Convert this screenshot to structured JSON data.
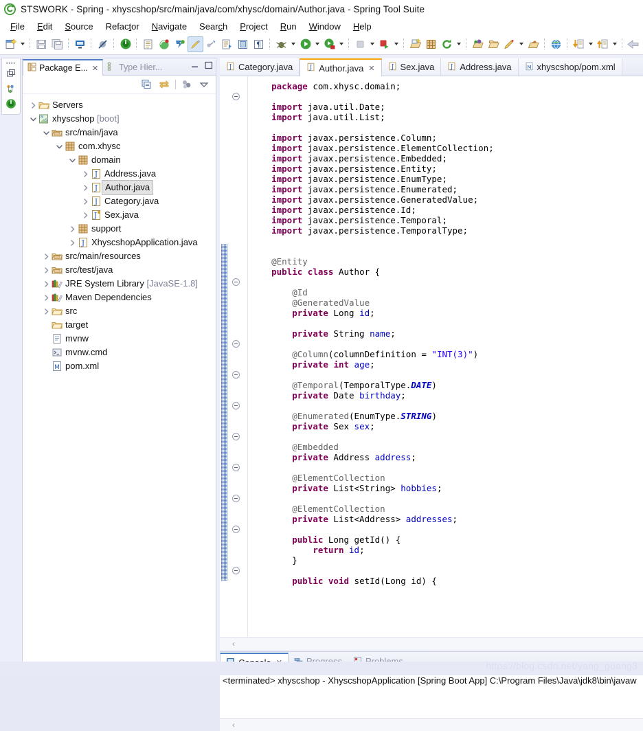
{
  "window": {
    "title": "STSWORK - Spring - xhyscshop/src/main/java/com/xhysc/domain/Author.java - Spring Tool Suite",
    "logo_icon": "sts-logo-icon"
  },
  "menubar": {
    "items": [
      {
        "label": "File",
        "mnemonic": "F"
      },
      {
        "label": "Edit",
        "mnemonic": "E"
      },
      {
        "label": "Source",
        "mnemonic": "S"
      },
      {
        "label": "Refactor",
        "mnemonic": "t"
      },
      {
        "label": "Navigate",
        "mnemonic": "N"
      },
      {
        "label": "Search",
        "mnemonic": "c"
      },
      {
        "label": "Project",
        "mnemonic": "P"
      },
      {
        "label": "Run",
        "mnemonic": "R"
      },
      {
        "label": "Window",
        "mnemonic": "W"
      },
      {
        "label": "Help",
        "mnemonic": "H"
      }
    ]
  },
  "toolbar": {
    "groups": [
      [
        "new-wizard-icon",
        "dropdown",
        "sep"
      ],
      [
        "save-icon",
        "save-all-icon",
        "sep"
      ],
      [
        "print-icon",
        "sep"
      ],
      [
        "toggle-breakpoint-icon",
        "sep"
      ],
      [
        "boot-dashboard-icon",
        "sep"
      ],
      [
        "new-java-class-icon",
        "spring-boot-icon",
        "spring-icon",
        "quick-access-highlight-icon",
        "link-icon",
        "externalize-strings-icon",
        "toggle-block-selection-icon",
        "show-whitespace-icon",
        "sep"
      ],
      [
        "debug-icon",
        "dropdown",
        "run-icon",
        "dropdown",
        "run-server-icon",
        "dropdown",
        "sep"
      ],
      [
        "stop-icon",
        "dropdown",
        "terminate-relaunch-icon",
        "dropdown",
        "sep"
      ],
      [
        "new-java-project-icon",
        "new-package-icon",
        "refresh-icon",
        "dropdown",
        "sep"
      ],
      [
        "open-type-icon",
        "open-task-icon",
        "new-annotation-icon",
        "dropdown",
        "open-resource-icon",
        "sep"
      ],
      [
        "web-browser-icon",
        "sep"
      ],
      [
        "previous-annotation-icon",
        "dropdown",
        "next-annotation-icon",
        "dropdown",
        "sep"
      ],
      [
        "back-icon",
        "forward-icon"
      ]
    ]
  },
  "fast_view": {
    "icons": [
      "restore-icon",
      "outline-minimized-icon",
      "boot-dashboard-minimized-icon"
    ]
  },
  "package_explorer": {
    "tabs": [
      {
        "label": "Package E...",
        "icon": "package-explorer-icon",
        "active": true,
        "closeable": true
      },
      {
        "label": "Type Hier...",
        "icon": "type-hierarchy-icon",
        "active": false,
        "closeable": false
      }
    ],
    "view_controls": [
      "minimize-icon",
      "maximize-icon"
    ],
    "toolbar_icons": [
      "collapse-all-icon",
      "link-with-editor-icon",
      "view-menu-focus-icon",
      "view-menu-icon"
    ],
    "tree": [
      {
        "indent": 0,
        "twisty": "collapsed",
        "icon": "folder-icon",
        "label": "Servers",
        "suffix": "",
        "selected": false
      },
      {
        "indent": 0,
        "twisty": "expanded",
        "icon": "spring-project-icon",
        "label": "xhyscshop",
        "suffix": " [boot]",
        "selected": false
      },
      {
        "indent": 1,
        "twisty": "expanded",
        "icon": "source-folder-icon",
        "label": "src/main/java",
        "suffix": "",
        "selected": false
      },
      {
        "indent": 2,
        "twisty": "expanded",
        "icon": "package-icon",
        "label": "com.xhysc",
        "suffix": "",
        "selected": false
      },
      {
        "indent": 3,
        "twisty": "expanded",
        "icon": "package-icon",
        "label": "domain",
        "suffix": "",
        "selected": false
      },
      {
        "indent": 4,
        "twisty": "collapsed",
        "icon": "java-file-icon",
        "label": "Address.java",
        "suffix": "",
        "selected": false
      },
      {
        "indent": 4,
        "twisty": "collapsed",
        "icon": "java-file-icon",
        "label": "Author.java",
        "suffix": "",
        "selected": true
      },
      {
        "indent": 4,
        "twisty": "collapsed",
        "icon": "java-file-icon",
        "label": "Category.java",
        "suffix": "",
        "selected": false
      },
      {
        "indent": 4,
        "twisty": "collapsed",
        "icon": "java-enum-file-icon",
        "label": "Sex.java",
        "suffix": "",
        "selected": false
      },
      {
        "indent": 3,
        "twisty": "collapsed",
        "icon": "package-icon",
        "label": "support",
        "suffix": "",
        "selected": false
      },
      {
        "indent": 3,
        "twisty": "collapsed",
        "icon": "java-file-icon",
        "label": "XhyscshopApplication.java",
        "suffix": "",
        "selected": false
      },
      {
        "indent": 1,
        "twisty": "collapsed",
        "icon": "source-folder-icon",
        "label": "src/main/resources",
        "suffix": "",
        "selected": false
      },
      {
        "indent": 1,
        "twisty": "collapsed",
        "icon": "source-folder-icon",
        "label": "src/test/java",
        "suffix": "",
        "selected": false
      },
      {
        "indent": 1,
        "twisty": "collapsed",
        "icon": "library-icon",
        "label": "JRE System Library",
        "suffix": " [JavaSE-1.8]",
        "selected": false
      },
      {
        "indent": 1,
        "twisty": "collapsed",
        "icon": "library-icon",
        "label": "Maven Dependencies",
        "suffix": "",
        "selected": false
      },
      {
        "indent": 1,
        "twisty": "collapsed",
        "icon": "folder-icon",
        "label": "src",
        "suffix": "",
        "selected": false
      },
      {
        "indent": 1,
        "twisty": "none",
        "icon": "folder-icon",
        "label": "target",
        "suffix": "",
        "selected": false
      },
      {
        "indent": 1,
        "twisty": "none",
        "icon": "file-icon",
        "label": "mvnw",
        "suffix": "",
        "selected": false
      },
      {
        "indent": 1,
        "twisty": "none",
        "icon": "cmd-file-icon",
        "label": "mvnw.cmd",
        "suffix": "",
        "selected": false
      },
      {
        "indent": 1,
        "twisty": "none",
        "icon": "xml-file-icon",
        "label": "pom.xml",
        "suffix": "",
        "selected": false
      }
    ]
  },
  "editor": {
    "tabs": [
      {
        "label": "Category.java",
        "icon": "java-file-icon",
        "active": false,
        "closeable": false
      },
      {
        "label": "Author.java",
        "icon": "java-file-icon",
        "active": true,
        "closeable": true
      },
      {
        "label": "Sex.java",
        "icon": "java-file-icon",
        "active": false,
        "closeable": false
      },
      {
        "label": "Address.java",
        "icon": "java-file-icon",
        "active": false,
        "closeable": false
      },
      {
        "label": "xhyscshop/pom.xml",
        "icon": "xml-file-icon",
        "active": false,
        "closeable": false
      }
    ],
    "hscroll_arrow": "‹",
    "code_lines": [
      [
        {
          "t": "    ",
          "c": ""
        },
        {
          "t": "package",
          "c": "kw"
        },
        {
          "t": " com.xhysc.domain;",
          "c": ""
        }
      ],
      [],
      [
        {
          "t": "    ",
          "c": ""
        },
        {
          "t": "import",
          "c": "kw"
        },
        {
          "t": " java.util.Date;",
          "c": ""
        }
      ],
      [
        {
          "t": "    ",
          "c": ""
        },
        {
          "t": "import",
          "c": "kw"
        },
        {
          "t": " java.util.List;",
          "c": ""
        }
      ],
      [],
      [
        {
          "t": "    ",
          "c": ""
        },
        {
          "t": "import",
          "c": "kw"
        },
        {
          "t": " javax.persistence.Column;",
          "c": ""
        }
      ],
      [
        {
          "t": "    ",
          "c": ""
        },
        {
          "t": "import",
          "c": "kw"
        },
        {
          "t": " javax.persistence.ElementCollection;",
          "c": ""
        }
      ],
      [
        {
          "t": "    ",
          "c": ""
        },
        {
          "t": "import",
          "c": "kw"
        },
        {
          "t": " javax.persistence.Embedded;",
          "c": ""
        }
      ],
      [
        {
          "t": "    ",
          "c": ""
        },
        {
          "t": "import",
          "c": "kw"
        },
        {
          "t": " javax.persistence.Entity;",
          "c": ""
        }
      ],
      [
        {
          "t": "    ",
          "c": ""
        },
        {
          "t": "import",
          "c": "kw"
        },
        {
          "t": " javax.persistence.EnumType;",
          "c": ""
        }
      ],
      [
        {
          "t": "    ",
          "c": ""
        },
        {
          "t": "import",
          "c": "kw"
        },
        {
          "t": " javax.persistence.Enumerated;",
          "c": ""
        }
      ],
      [
        {
          "t": "    ",
          "c": ""
        },
        {
          "t": "import",
          "c": "kw"
        },
        {
          "t": " javax.persistence.GeneratedValue;",
          "c": ""
        }
      ],
      [
        {
          "t": "    ",
          "c": ""
        },
        {
          "t": "import",
          "c": "kw"
        },
        {
          "t": " javax.persistence.Id;",
          "c": ""
        }
      ],
      [
        {
          "t": "    ",
          "c": ""
        },
        {
          "t": "import",
          "c": "kw"
        },
        {
          "t": " javax.persistence.Temporal;",
          "c": ""
        }
      ],
      [
        {
          "t": "    ",
          "c": ""
        },
        {
          "t": "import",
          "c": "kw"
        },
        {
          "t": " javax.persistence.TemporalType;",
          "c": ""
        }
      ],
      [],
      [],
      [
        {
          "t": "    ",
          "c": ""
        },
        {
          "t": "@Entity",
          "c": "an"
        }
      ],
      [
        {
          "t": "    ",
          "c": ""
        },
        {
          "t": "public",
          "c": "kw"
        },
        {
          "t": " ",
          "c": ""
        },
        {
          "t": "class",
          "c": "kw"
        },
        {
          "t": " Author {",
          "c": ""
        }
      ],
      [],
      [
        {
          "t": "        ",
          "c": ""
        },
        {
          "t": "@Id",
          "c": "an"
        }
      ],
      [
        {
          "t": "        ",
          "c": ""
        },
        {
          "t": "@GeneratedValue",
          "c": "an"
        }
      ],
      [
        {
          "t": "        ",
          "c": ""
        },
        {
          "t": "private",
          "c": "kw"
        },
        {
          "t": " Long ",
          "c": ""
        },
        {
          "t": "id",
          "c": "fld"
        },
        {
          "t": ";",
          "c": ""
        }
      ],
      [],
      [
        {
          "t": "        ",
          "c": ""
        },
        {
          "t": "private",
          "c": "kw"
        },
        {
          "t": " String ",
          "c": ""
        },
        {
          "t": "name",
          "c": "fld"
        },
        {
          "t": ";",
          "c": ""
        }
      ],
      [],
      [
        {
          "t": "        ",
          "c": ""
        },
        {
          "t": "@Column",
          "c": "an"
        },
        {
          "t": "(columnDefinition = ",
          "c": ""
        },
        {
          "t": "\"INT(3)\"",
          "c": "str"
        },
        {
          "t": ")",
          "c": ""
        }
      ],
      [
        {
          "t": "        ",
          "c": ""
        },
        {
          "t": "private",
          "c": "kw"
        },
        {
          "t": " ",
          "c": ""
        },
        {
          "t": "int",
          "c": "kw"
        },
        {
          "t": " ",
          "c": ""
        },
        {
          "t": "age",
          "c": "fld"
        },
        {
          "t": ";",
          "c": ""
        }
      ],
      [],
      [
        {
          "t": "        ",
          "c": ""
        },
        {
          "t": "@Temporal",
          "c": "an"
        },
        {
          "t": "(TemporalType.",
          "c": ""
        },
        {
          "t": "DATE",
          "c": "stc"
        },
        {
          "t": ")",
          "c": ""
        }
      ],
      [
        {
          "t": "        ",
          "c": ""
        },
        {
          "t": "private",
          "c": "kw"
        },
        {
          "t": " Date ",
          "c": ""
        },
        {
          "t": "birthday",
          "c": "fld"
        },
        {
          "t": ";",
          "c": ""
        }
      ],
      [],
      [
        {
          "t": "        ",
          "c": ""
        },
        {
          "t": "@Enumerated",
          "c": "an"
        },
        {
          "t": "(EnumType.",
          "c": ""
        },
        {
          "t": "STRING",
          "c": "stc"
        },
        {
          "t": ")",
          "c": ""
        }
      ],
      [
        {
          "t": "        ",
          "c": ""
        },
        {
          "t": "private",
          "c": "kw"
        },
        {
          "t": " Sex ",
          "c": ""
        },
        {
          "t": "sex",
          "c": "fld"
        },
        {
          "t": ";",
          "c": ""
        }
      ],
      [],
      [
        {
          "t": "        ",
          "c": ""
        },
        {
          "t": "@Embedded",
          "c": "an"
        }
      ],
      [
        {
          "t": "        ",
          "c": ""
        },
        {
          "t": "private",
          "c": "kw"
        },
        {
          "t": " Address ",
          "c": ""
        },
        {
          "t": "address",
          "c": "fld"
        },
        {
          "t": ";",
          "c": ""
        }
      ],
      [],
      [
        {
          "t": "        ",
          "c": ""
        },
        {
          "t": "@ElementCollection",
          "c": "an"
        }
      ],
      [
        {
          "t": "        ",
          "c": ""
        },
        {
          "t": "private",
          "c": "kw"
        },
        {
          "t": " List<String> ",
          "c": ""
        },
        {
          "t": "hobbies",
          "c": "fld"
        },
        {
          "t": ";",
          "c": ""
        }
      ],
      [],
      [
        {
          "t": "        ",
          "c": ""
        },
        {
          "t": "@ElementCollection",
          "c": "an"
        }
      ],
      [
        {
          "t": "        ",
          "c": ""
        },
        {
          "t": "private",
          "c": "kw"
        },
        {
          "t": " List<Address> ",
          "c": ""
        },
        {
          "t": "addresses",
          "c": "fld"
        },
        {
          "t": ";",
          "c": ""
        }
      ],
      [],
      [
        {
          "t": "        ",
          "c": ""
        },
        {
          "t": "public",
          "c": "kw"
        },
        {
          "t": " Long getId() {",
          "c": ""
        }
      ],
      [
        {
          "t": "            ",
          "c": ""
        },
        {
          "t": "return",
          "c": "kw"
        },
        {
          "t": " ",
          "c": ""
        },
        {
          "t": "id",
          "c": "fld"
        },
        {
          "t": ";",
          "c": ""
        }
      ],
      [
        {
          "t": "        }",
          "c": ""
        }
      ],
      [],
      [
        {
          "t": "        ",
          "c": ""
        },
        {
          "t": "public",
          "c": "kw"
        },
        {
          "t": " ",
          "c": ""
        },
        {
          "t": "void",
          "c": "kw"
        },
        {
          "t": " setId(Long id) {",
          "c": ""
        }
      ]
    ],
    "fold_rows": [
      2,
      20,
      26,
      29,
      32,
      35,
      38,
      41,
      44,
      48
    ]
  },
  "console": {
    "tabs": [
      {
        "label": "Console",
        "icon": "console-icon",
        "active": true,
        "closeable": true
      },
      {
        "label": "Progress",
        "icon": "progress-icon",
        "active": false,
        "closeable": false
      },
      {
        "label": "Problems",
        "icon": "problems-icon",
        "active": false,
        "closeable": false
      }
    ],
    "output": "<terminated> xhyscshop - XhyscshopApplication [Spring Boot App] C:\\Program Files\\Java\\jdk8\\bin\\javaw",
    "hscroll_arrow": "‹"
  },
  "watermark": "https://blog.csdn.net/yang_guang3",
  "colors": {
    "keyword": "#7f0055",
    "annotation": "#646464",
    "field": "#0000c0",
    "string": "#2a00ff",
    "active_tab_accent": "#f3a60b",
    "view_tab_accent": "#4f7fc4",
    "selection": "#e4e4e4",
    "chrome": "#eceefa"
  }
}
